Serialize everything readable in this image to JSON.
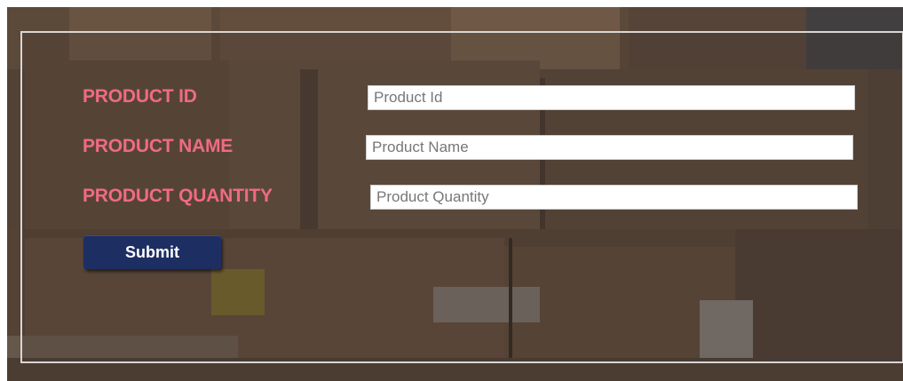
{
  "form": {
    "fields": [
      {
        "label": "PRODUCT ID",
        "placeholder": "Product Id",
        "value": ""
      },
      {
        "label": "PRODUCT NAME",
        "placeholder": "Product Name",
        "value": ""
      },
      {
        "label": "PRODUCT QUANTITY",
        "placeholder": "Product Quantity",
        "value": ""
      }
    ],
    "submit_label": "Submit"
  },
  "colors": {
    "label": "#f06a85",
    "button_bg": "#1d2e63",
    "button_text": "#ffffff",
    "frame_border": "#d9d6d3"
  },
  "background": {
    "description_icon": "cardboard-boxes-photo"
  }
}
